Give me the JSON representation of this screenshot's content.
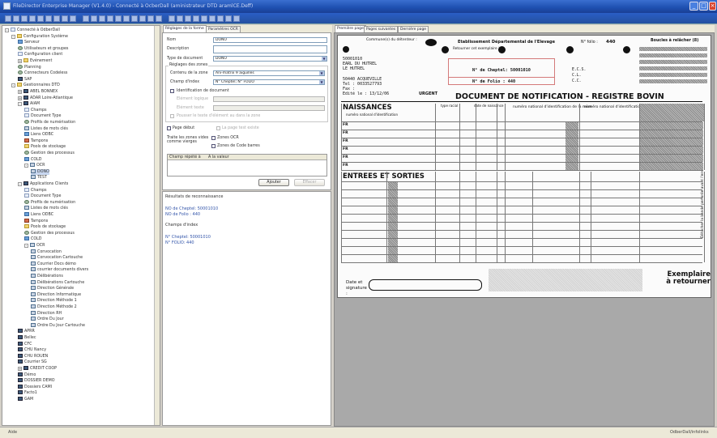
{
  "window": {
    "title": "FileDirector Enterprise Manager (V1.4.0) - Connecté à OcberDall (aministrateur DTD aramlCE.Deff)"
  },
  "tree": {
    "items": [
      {
        "label": "Connecté à OdberDall",
        "icon": "computer",
        "level": 0,
        "expander": "-"
      },
      {
        "label": "Configuration Système",
        "icon": "folder",
        "level": 1,
        "expander": "-"
      },
      {
        "label": "Serveur",
        "icon": "db",
        "level": 2
      },
      {
        "label": "Utilisateurs et groupes",
        "icon": "gear",
        "level": 2
      },
      {
        "label": "Configuration client",
        "icon": "doc",
        "level": 2
      },
      {
        "label": "Evénement",
        "icon": "folder",
        "level": 2,
        "expander": "+"
      },
      {
        "label": "Planning",
        "icon": "gear",
        "level": 2
      },
      {
        "label": "Connecteurs Codeless",
        "icon": "gear",
        "level": 2
      },
      {
        "label": "SAP",
        "icon": "dark",
        "level": 2
      },
      {
        "label": "Gestionnaires DTD",
        "icon": "folder",
        "level": 1,
        "expander": "-"
      },
      {
        "label": "ABEL BONNEX",
        "icon": "dark",
        "level": 2,
        "expander": "+"
      },
      {
        "label": "ADAR Loire-Atlantique",
        "icon": "dark",
        "level": 2,
        "expander": "+"
      },
      {
        "label": "AIAM",
        "icon": "dark",
        "level": 2,
        "expander": "-"
      },
      {
        "label": "Champs",
        "icon": "doc",
        "level": 3
      },
      {
        "label": "Document Type",
        "icon": "doc",
        "level": 3
      },
      {
        "label": "Profils de numérisation",
        "icon": "gear",
        "level": 3
      },
      {
        "label": "Listes de mots clés",
        "icon": "grid",
        "level": 3
      },
      {
        "label": "Liens ODBC",
        "icon": "db",
        "level": 3
      },
      {
        "label": "Tampons",
        "icon": "red",
        "level": 3
      },
      {
        "label": "Pools de stockage",
        "icon": "folder",
        "level": 3
      },
      {
        "label": "Gestion des processus",
        "icon": "gear",
        "level": 3
      },
      {
        "label": "COLD",
        "icon": "db",
        "level": 3
      },
      {
        "label": "OCR",
        "icon": "grid",
        "level": 3,
        "expander": "-"
      },
      {
        "label": "DONO",
        "icon": "grid",
        "level": 4,
        "selected": true
      },
      {
        "label": "TEST",
        "icon": "grid",
        "level": 4
      },
      {
        "label": "Applications Clients",
        "icon": "dark",
        "level": 2,
        "expander": "-"
      },
      {
        "label": "Champs",
        "icon": "doc",
        "level": 3
      },
      {
        "label": "Document Type",
        "icon": "doc",
        "level": 3
      },
      {
        "label": "Profils de numérisation",
        "icon": "gear",
        "level": 3
      },
      {
        "label": "Listes de mots clés",
        "icon": "grid",
        "level": 3
      },
      {
        "label": "Liens ODBC",
        "icon": "db",
        "level": 3
      },
      {
        "label": "Tampons",
        "icon": "red",
        "level": 3
      },
      {
        "label": "Pools de stockage",
        "icon": "folder",
        "level": 3
      },
      {
        "label": "Gestion des processus",
        "icon": "gear",
        "level": 3
      },
      {
        "label": "COLD",
        "icon": "db",
        "level": 3
      },
      {
        "label": "OCR",
        "icon": "grid",
        "level": 3,
        "expander": "-"
      },
      {
        "label": "Convocation",
        "icon": "grid",
        "level": 4
      },
      {
        "label": "Convocation Cartouche",
        "icon": "grid",
        "level": 4
      },
      {
        "label": "Courrier Docs démo",
        "icon": "grid",
        "level": 4
      },
      {
        "label": "courrier documents divers",
        "icon": "grid",
        "level": 4
      },
      {
        "label": "Délibérations",
        "icon": "grid",
        "level": 4
      },
      {
        "label": "Délibérations Cartouche",
        "icon": "grid",
        "level": 4
      },
      {
        "label": "Direction Générale",
        "icon": "grid",
        "level": 4
      },
      {
        "label": "Direction Informatique",
        "icon": "grid",
        "level": 4
      },
      {
        "label": "Direction Méthode 1",
        "icon": "grid",
        "level": 4
      },
      {
        "label": "Direction Méthode 2",
        "icon": "grid",
        "level": 4
      },
      {
        "label": "Direction RH",
        "icon": "grid",
        "level": 4
      },
      {
        "label": "Ordre Du Jour",
        "icon": "grid",
        "level": 4
      },
      {
        "label": "Ordre Du Jour Cartouche",
        "icon": "grid",
        "level": 4
      },
      {
        "label": "APRR",
        "icon": "dark",
        "level": 2
      },
      {
        "label": "Bellec",
        "icon": "dark",
        "level": 2
      },
      {
        "label": "CFC",
        "icon": "dark",
        "level": 2
      },
      {
        "label": "CHU Nancy",
        "icon": "dark",
        "level": 2
      },
      {
        "label": "CHU ROUEN",
        "icon": "dark",
        "level": 2
      },
      {
        "label": "Courrier SG",
        "icon": "dark",
        "level": 2
      },
      {
        "label": "CREDIT COOP",
        "icon": "dark",
        "level": 2,
        "expander": "+"
      },
      {
        "label": "Démo",
        "icon": "dark",
        "level": 2
      },
      {
        "label": "DOSSIER DEMO",
        "icon": "dark",
        "level": 2
      },
      {
        "label": "Dossiers CAMI",
        "icon": "dark",
        "level": 2
      },
      {
        "label": "Facto1",
        "icon": "dark",
        "level": 2
      },
      {
        "label": "GAM",
        "icon": "dark",
        "level": 2
      }
    ]
  },
  "middle": {
    "tabs": [
      "Réglages de la forme",
      "Paramètres OCR"
    ],
    "form": {
      "nom_label": "Nom",
      "nom_value": "DONO",
      "description_label": "Description",
      "description_value": "",
      "type_label": "Type de document",
      "type_value": "DONO",
      "zones_group": "Réglages des zones",
      "contenu_label": "Contenu de la zone",
      "contenu_value": "Ani-matrix 9 aiguilles",
      "champ_label": "Champ d'index",
      "champ_value": "N° Cheptel; N° FOLIO",
      "ident_doc": "Identification de document",
      "element_logique": "Elément logique",
      "element_texte": "Elément texte",
      "pousser_texte": "Pousser le texte d'élément au dans la zone",
      "page_debut": "Page début",
      "page_test": "La page test existe",
      "traite_label": "Traite les zones vides comme vierges",
      "zones_ocr": "Zones OCR",
      "zones_codebarre": "Zones de Code barres",
      "col_champ": "Champ répété à",
      "col_valeur": "A la valeur",
      "ajouter": "Ajouter",
      "effacer": "Effacer"
    },
    "results": {
      "title": "Résultats de reconnaissance",
      "line1": "NO de Cheptel: 50001010",
      "line2": "NO de Folio : 440",
      "champs_title": "Champs d'index",
      "idx1": "N° Cheptel: 50001010",
      "idx2": "N° FOLIO: 440"
    }
  },
  "viewer": {
    "tabs": [
      "Première page",
      "Pages suivantes",
      "Dernière page"
    ],
    "doc": {
      "commune_label": "Commune(s) du détenteur :",
      "etab": "Etablissement Départemental de l'Elevage",
      "folio_label": "N° folio :",
      "folio_value": "440",
      "boucles": "Boucles à relâcher (8)",
      "exemplaire": "Retourner cet exemplaire à :",
      "cheptel_code": "50001010",
      "earl": "EARL DU HUTREL",
      "le_hutrel": "LE HUTREL",
      "ville": "50440 ACQUEVILLE",
      "tel": "Tel : 0033527793",
      "fax": "Fax :",
      "edite": "Edité le : 13/12/06",
      "urgent": "URGENT",
      "ncheptel_label": "N° de Cheptel: 50001010",
      "nfolio_label": "N° de Folio :    440",
      "ecs": "E.C.S.",
      "cl": "C.L.",
      "cc": "C.C.",
      "doc_title": "DOCUMENT DE NOTIFICATION - REGISTRE BOVIN",
      "naissances": "NAISSANCES",
      "entrees": "ENTREES ET SORTIES",
      "col_numero": "numéro national d'identification",
      "col_type": "type racial",
      "col_date": "date de naissance",
      "col_mere": "numéro national d'identification de la mère",
      "col_pere": "numéro national d'identification du père",
      "row_fr": "FR",
      "date_sign": "Date et signature :",
      "exemplaire_retour": "Exemplaire à retourner",
      "side_text": "Détacher la bande perforée avant l'envoi"
    }
  },
  "status": {
    "left": "Aide",
    "right": "OdberDall/infolinks"
  },
  "colors": {
    "titlebar": "#1e4fb0",
    "accent_link": "#3355aa",
    "selection": "#c7d6ef"
  }
}
